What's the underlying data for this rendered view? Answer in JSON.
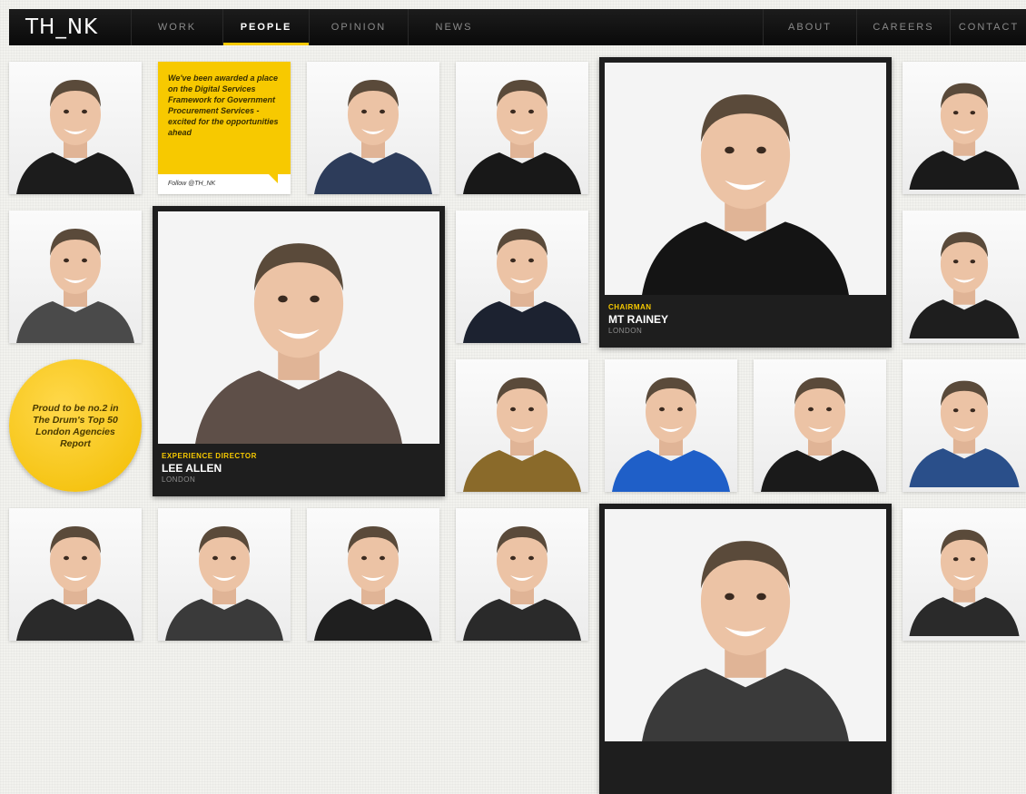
{
  "header": {
    "logo": "TH_NK",
    "nav": [
      "WORK",
      "PEOPLE",
      "OPINION",
      "NEWS"
    ],
    "nav_right": [
      "ABOUT",
      "CAREERS",
      "CONTACT"
    ],
    "active": "PEOPLE",
    "accent": "#f7c900"
  },
  "tweet": {
    "text": "We've been awarded a place on the Digital Services Framework for Government Procurement Services - excited for the opportunities ahead",
    "follow": "Follow @TH_NK"
  },
  "award": {
    "text": "Proud to be no.2 in The Drum's Top 50 London Agencies Report"
  },
  "featured": [
    {
      "role": "EXPERIENCE DIRECTOR",
      "name": "LEE ALLEN",
      "location": "LONDON"
    },
    {
      "role": "CHAIRMAN",
      "name": "MT RAINEY",
      "location": "LONDON"
    }
  ]
}
